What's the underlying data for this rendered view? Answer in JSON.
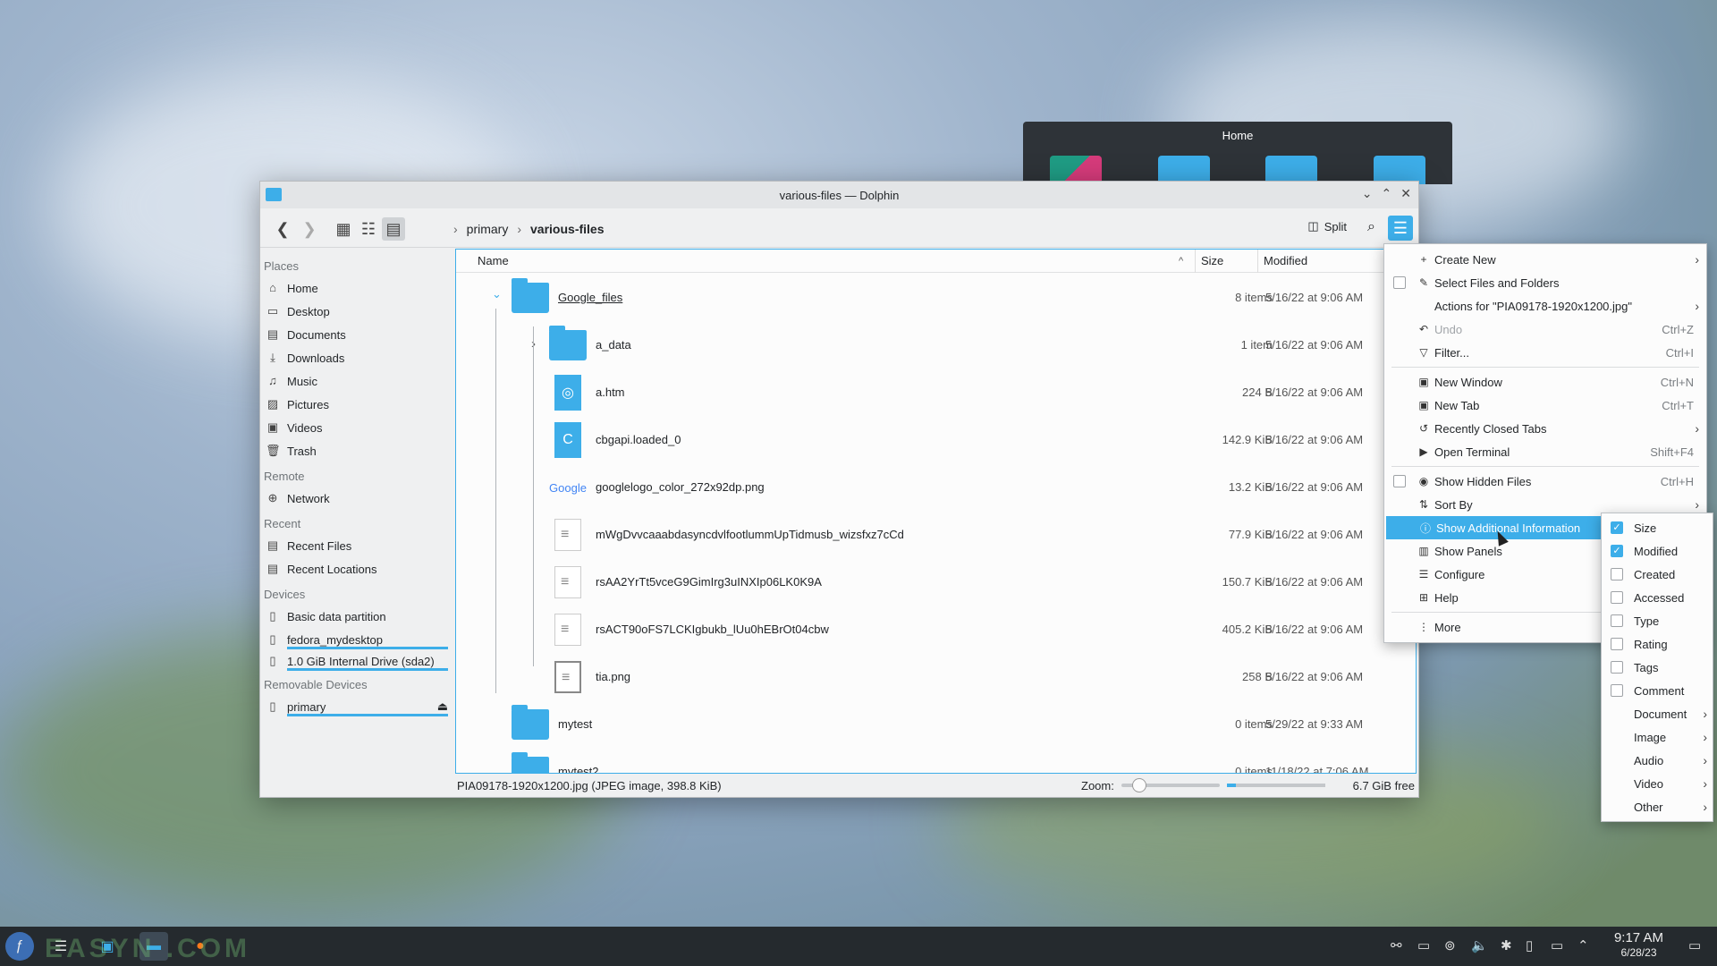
{
  "home_preview": {
    "title": "Home"
  },
  "window": {
    "title": "various-files — Dolphin",
    "min_glyph": "⌄",
    "max_glyph": "⌃",
    "close_glyph": "✕"
  },
  "toolbar": {
    "back_icon": "back-icon",
    "forward_icon": "forward-icon",
    "breadcrumb": [
      "primary",
      "various-files"
    ],
    "split_label": "Split"
  },
  "sidebar": {
    "places_title": "Places",
    "places": [
      {
        "label": "Home",
        "icon": "home-icon",
        "glyph": "⌂"
      },
      {
        "label": "Desktop",
        "icon": "desktop-icon",
        "glyph": "▭"
      },
      {
        "label": "Documents",
        "icon": "documents-icon",
        "glyph": "▤"
      },
      {
        "label": "Downloads",
        "icon": "downloads-icon",
        "glyph": "⤓"
      },
      {
        "label": "Music",
        "icon": "music-icon",
        "glyph": "♫"
      },
      {
        "label": "Pictures",
        "icon": "pictures-icon",
        "glyph": "▨"
      },
      {
        "label": "Videos",
        "icon": "videos-icon",
        "glyph": "▣"
      },
      {
        "label": "Trash",
        "icon": "trash-icon",
        "glyph": "🗑"
      }
    ],
    "remote_title": "Remote",
    "remote": [
      {
        "label": "Network",
        "icon": "network-icon",
        "glyph": "⊕"
      }
    ],
    "recent_title": "Recent",
    "recent": [
      {
        "label": "Recent Files",
        "icon": "recent-files-icon",
        "glyph": "▤"
      },
      {
        "label": "Recent Locations",
        "icon": "recent-locations-icon",
        "glyph": "▤"
      }
    ],
    "devices_title": "Devices",
    "devices": [
      {
        "label": "Basic data partition",
        "icon": "drive-icon",
        "glyph": "▯"
      },
      {
        "label": "fedora_mydesktop",
        "icon": "drive-icon",
        "glyph": "▯"
      },
      {
        "label": "1.0 GiB Internal Drive (sda2)",
        "icon": "drive-icon",
        "glyph": "▯"
      }
    ],
    "removable_title": "Removable Devices",
    "removable": [
      {
        "label": "primary",
        "icon": "usb-drive-icon",
        "glyph": "▯"
      }
    ],
    "eject_glyph": "⏏"
  },
  "columns": {
    "name": "Name",
    "size": "Size",
    "modified": "Modified",
    "sort_glyph": "^"
  },
  "files": [
    {
      "name": "Google_files",
      "size": "8 items",
      "modified": "5/16/22 at 9:06 AM",
      "icon": "folder-icon"
    },
    {
      "name": "a_data",
      "size": "1 item",
      "modified": "5/16/22 at 9:06 AM",
      "icon": "folder-icon"
    },
    {
      "name": "a.htm",
      "size": "224 B",
      "modified": "5/16/22 at 9:06 AM",
      "icon": "html-file-icon"
    },
    {
      "name": "cbgapi.loaded_0",
      "size": "142.9 KiB",
      "modified": "5/16/22 at 9:06 AM",
      "icon": "script-file-icon"
    },
    {
      "name": "googlelogo_color_272x92dp.png",
      "size": "13.2 KiB",
      "modified": "5/16/22 at 9:06 AM",
      "icon": "google-logo-icon"
    },
    {
      "name": "mWgDvvcaaabdasyncdvlfootlummUpTidmusb_wizsfxz7cCd",
      "size": "77.9 KiB",
      "modified": "5/16/22 at 9:06 AM",
      "icon": "text-file-icon"
    },
    {
      "name": "rsAA2YrTt5vceG9GimIrg3uINXIp06LK0K9A",
      "size": "150.7 KiB",
      "modified": "5/16/22 at 9:06 AM",
      "icon": "text-file-icon"
    },
    {
      "name": "rsACT90oFS7LCKIgbukb_lUu0hEBrOt04cbw",
      "size": "405.2 KiB",
      "modified": "5/16/22 at 9:06 AM",
      "icon": "text-file-icon"
    },
    {
      "name": "tia.png",
      "size": "258 B",
      "modified": "5/16/22 at 9:06 AM",
      "icon": "image-file-icon"
    },
    {
      "name": "mytest",
      "size": "0 items",
      "modified": "5/29/22 at 9:33 AM",
      "icon": "folder-icon"
    },
    {
      "name": "mytest2",
      "size": "0 items",
      "modified": "11/18/22 at 7:06 AM",
      "icon": "folder-icon"
    }
  ],
  "statusbar": {
    "info": "PIA09178-1920x1200.jpg (JPEG image, 398.8 KiB)",
    "zoom_label": "Zoom:",
    "free": "6.7 GiB free"
  },
  "main_menu": [
    {
      "label": "Create New",
      "icon": "plus-icon",
      "glyph": "+",
      "arrow": true
    },
    {
      "label": "Select Files and Folders",
      "icon": "pencil-icon",
      "glyph": "✎",
      "checkbox": true
    },
    {
      "label": "Actions for \"PIA09178-1920x1200.jpg\"",
      "arrow": true
    },
    {
      "label": "Undo",
      "icon": "undo-icon",
      "glyph": "↶",
      "shortcut": "Ctrl+Z",
      "disabled": true
    },
    {
      "label": "Filter...",
      "icon": "filter-icon",
      "glyph": "▽",
      "shortcut": "Ctrl+I"
    },
    {
      "sep": true
    },
    {
      "label": "New Window",
      "icon": "new-window-icon",
      "glyph": "▣",
      "shortcut": "Ctrl+N"
    },
    {
      "label": "New Tab",
      "icon": "new-tab-icon",
      "glyph": "▣",
      "shortcut": "Ctrl+T"
    },
    {
      "label": "Recently Closed Tabs",
      "icon": "history-icon",
      "glyph": "↺",
      "arrow": true
    },
    {
      "label": "Open Terminal",
      "icon": "terminal-icon",
      "glyph": "▶",
      "shortcut": "Shift+F4"
    },
    {
      "sep": true
    },
    {
      "label": "Show Hidden Files",
      "icon": "eye-icon",
      "glyph": "◉",
      "shortcut": "Ctrl+H",
      "checkbox": true
    },
    {
      "label": "Sort By",
      "icon": "sort-icon",
      "glyph": "⇅",
      "arrow": true
    },
    {
      "label": "Show Additional Information",
      "icon": "info-icon",
      "glyph": "ⓘ",
      "arrow": true,
      "highlight": true
    },
    {
      "label": "Show Panels",
      "icon": "panels-icon",
      "glyph": "▥",
      "arrow": true
    },
    {
      "label": "Configure",
      "icon": "configure-icon",
      "glyph": "☰",
      "arrow": true
    },
    {
      "label": "Help",
      "icon": "help-icon",
      "glyph": "⊞",
      "arrow": true
    },
    {
      "sep": true
    },
    {
      "label": "More",
      "icon": "more-icon",
      "glyph": "⋮",
      "arrow": true
    }
  ],
  "sub_menu": [
    {
      "label": "Size",
      "checked": true
    },
    {
      "label": "Modified",
      "checked": true
    },
    {
      "label": "Created",
      "checked": false
    },
    {
      "label": "Accessed",
      "checked": false
    },
    {
      "label": "Type",
      "checked": false
    },
    {
      "label": "Rating",
      "checked": false
    },
    {
      "label": "Tags",
      "checked": false
    },
    {
      "label": "Comment",
      "checked": false
    },
    {
      "label": "Document",
      "arrow": true
    },
    {
      "label": "Image",
      "arrow": true
    },
    {
      "label": "Audio",
      "arrow": true
    },
    {
      "label": "Video",
      "arrow": true
    },
    {
      "label": "Other",
      "arrow": true
    }
  ],
  "taskbar": {
    "watermark": "EASYN .COM",
    "time": "9:17 AM",
    "date": "6/28/23"
  }
}
